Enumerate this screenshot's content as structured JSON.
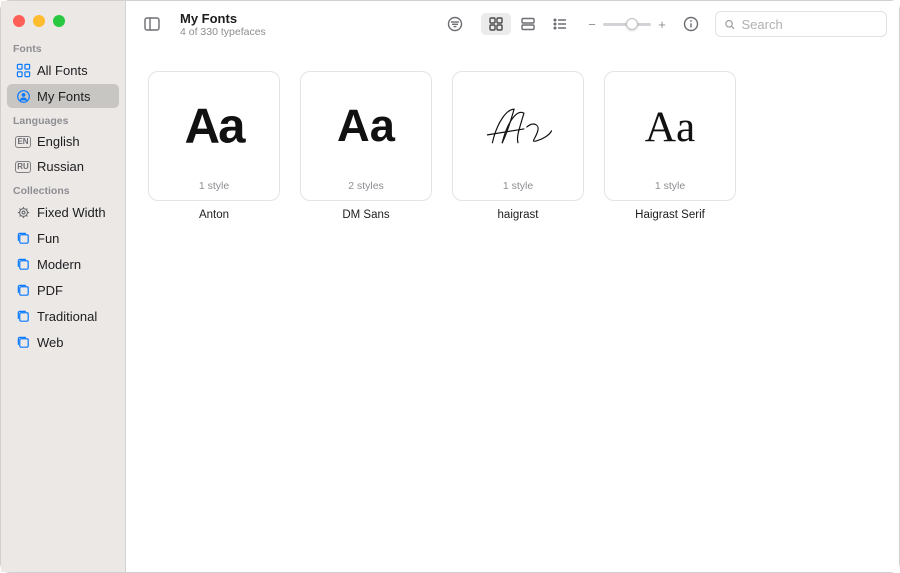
{
  "header": {
    "title": "My Fonts",
    "subtitle": "4 of 330 typefaces"
  },
  "search": {
    "placeholder": "Search"
  },
  "sidebar": {
    "sections": [
      {
        "title": "Fonts",
        "items": [
          {
            "label": "All Fonts"
          },
          {
            "label": "My Fonts"
          }
        ]
      },
      {
        "title": "Languages",
        "items": [
          {
            "label": "English",
            "badge": "EN"
          },
          {
            "label": "Russian",
            "badge": "RU"
          }
        ]
      },
      {
        "title": "Collections",
        "items": [
          {
            "label": "Fixed Width"
          },
          {
            "label": "Fun"
          },
          {
            "label": "Modern"
          },
          {
            "label": "PDF"
          },
          {
            "label": "Traditional"
          },
          {
            "label": "Web"
          }
        ]
      }
    ]
  },
  "fonts": [
    {
      "name": "Anton",
      "styles": "1 style"
    },
    {
      "name": "DM Sans",
      "styles": "2 styles"
    },
    {
      "name": "haigrast",
      "styles": "1 style"
    },
    {
      "name": "Haigrast Serif",
      "styles": "1 style"
    }
  ],
  "zoom": {
    "minus": "−",
    "plus": "+"
  }
}
